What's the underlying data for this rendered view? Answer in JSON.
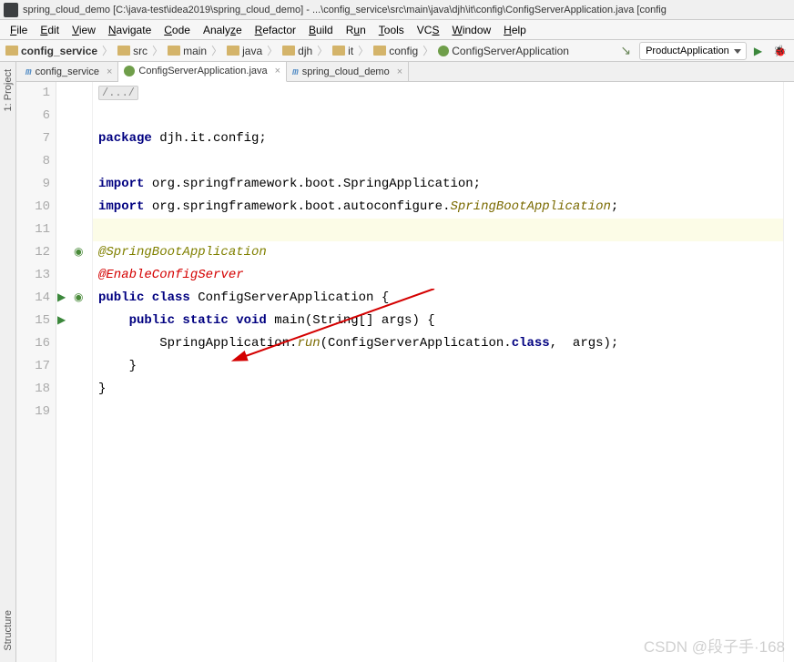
{
  "window": {
    "title": "spring_cloud_demo [C:\\java-test\\idea2019\\spring_cloud_demo] - ...\\config_service\\src\\main\\java\\djh\\it\\config\\ConfigServerApplication.java [config"
  },
  "menu": [
    "File",
    "Edit",
    "View",
    "Navigate",
    "Code",
    "Analyze",
    "Refactor",
    "Build",
    "Run",
    "Tools",
    "VCS",
    "Window",
    "Help"
  ],
  "breadcrumbs": [
    {
      "label": "config_service",
      "bold": true,
      "icon": "folder"
    },
    {
      "label": "src",
      "icon": "folder"
    },
    {
      "label": "main",
      "icon": "folder"
    },
    {
      "label": "java",
      "icon": "folder"
    },
    {
      "label": "djh",
      "icon": "folder"
    },
    {
      "label": "it",
      "icon": "folder"
    },
    {
      "label": "config",
      "icon": "folder"
    },
    {
      "label": "ConfigServerApplication",
      "icon": "class"
    }
  ],
  "run_config": "ProductApplication",
  "tabs": [
    {
      "label": "config_service",
      "icon": "m",
      "active": false
    },
    {
      "label": "ConfigServerApplication.java",
      "icon": "c",
      "active": true
    },
    {
      "label": "spring_cloud_demo",
      "icon": "m",
      "active": false
    }
  ],
  "gutter_lines": [
    "1",
    "6",
    "7",
    "8",
    "9",
    "10",
    "11",
    "12",
    "13",
    "14",
    "15",
    "16",
    "17",
    "18",
    "19"
  ],
  "code": {
    "l1_fold": "/.../",
    "l7_pkg_kw": "package ",
    "l7_pkg_rest": "djh.it.config;",
    "l9_imp_kw": "import ",
    "l9_imp_rest": "org.springframework.boot.SpringApplication;",
    "l10_imp_kw": "import ",
    "l10_imp_rest_a": "org.springframework.boot.autoconfigure.",
    "l10_imp_rest_b": "SpringBootApplication",
    "l10_semi": ";",
    "l12_ann": "@SpringBootApplication",
    "l13_err": "@EnableConfigServer",
    "l14_a": "public class ",
    "l14_b": "ConfigServerApplication {",
    "l15_a": "    public static void ",
    "l15_b": "main(String[] args) {",
    "l16": "        SpringApplication.",
    "l16_fn": "run",
    "l16_b": "(ConfigServerApplication.",
    "l16_kw": "class",
    "l16_c": ",  args);",
    "l17": "    }",
    "l18": "}"
  },
  "side": {
    "project": "1: Project",
    "structure": "Structure"
  },
  "watermark": "CSDN @段子手·168"
}
